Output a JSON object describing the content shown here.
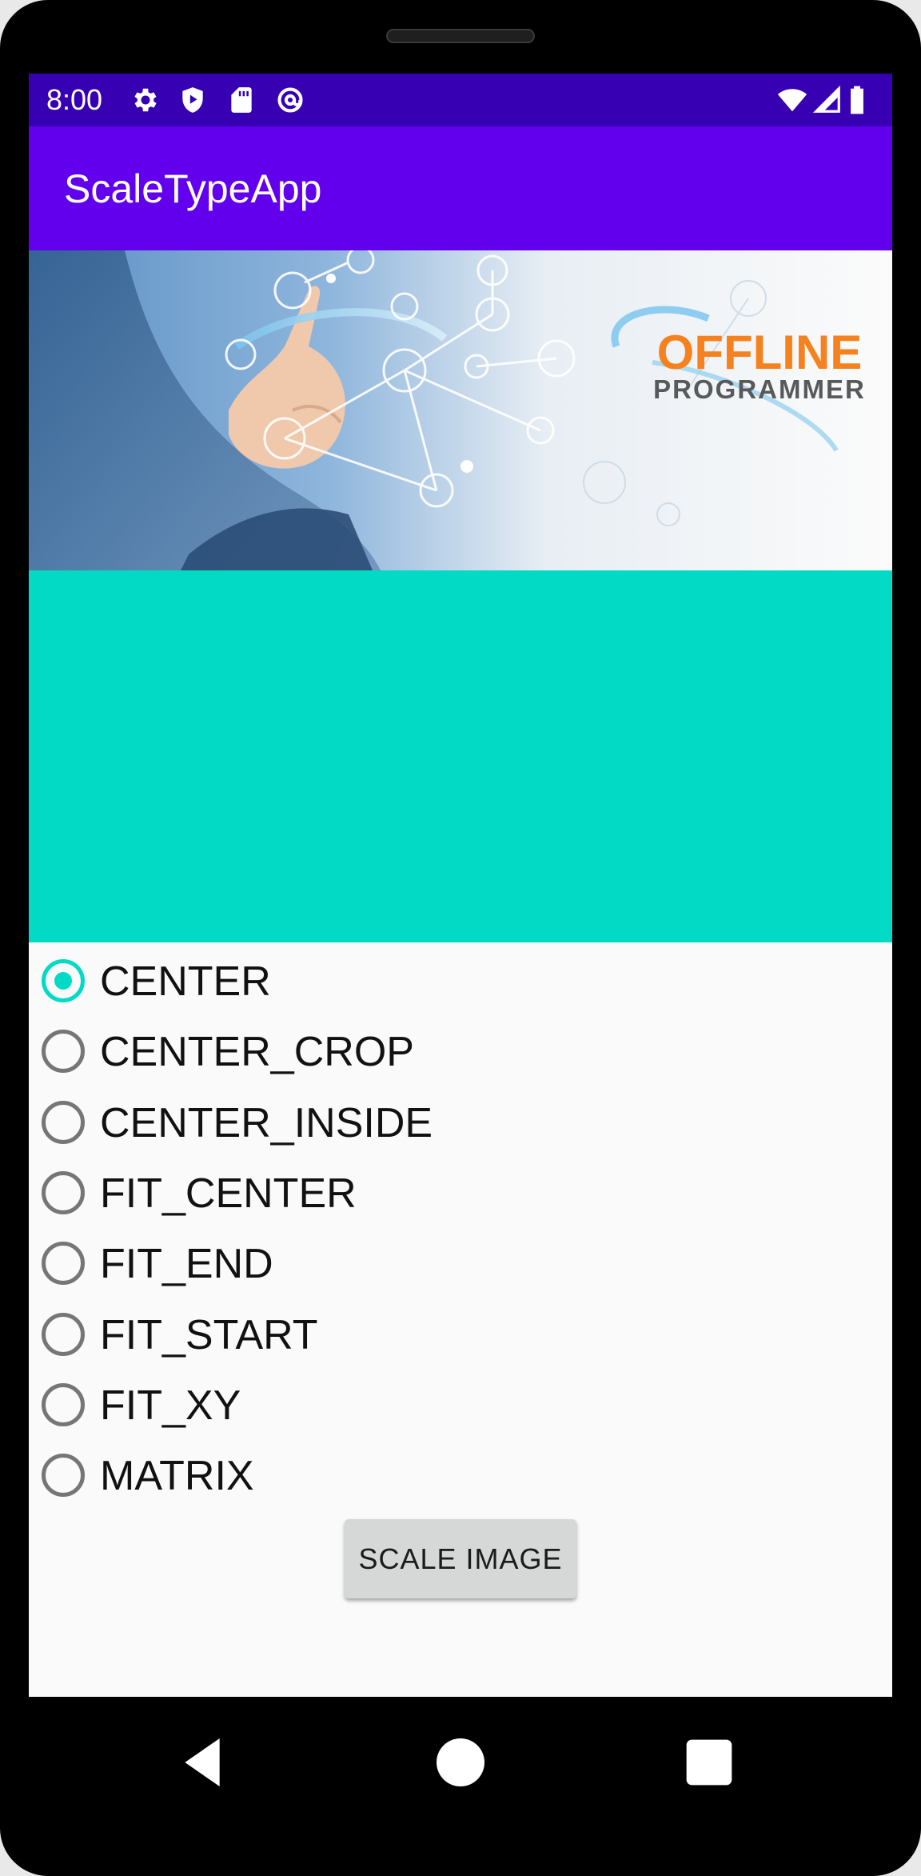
{
  "status_bar": {
    "time": "8:00",
    "left_icons": [
      "gear-icon",
      "shield-play-icon",
      "sd-card-icon",
      "at-sign-icon"
    ],
    "right_icons": [
      "wifi-icon",
      "cell-signal-icon",
      "battery-icon"
    ]
  },
  "app_bar": {
    "title": "ScaleTypeApp"
  },
  "banner": {
    "logo_line1": "OFFLINE",
    "logo_line2": "PROGRAMMER",
    "logo_color": "#f5821f"
  },
  "image_view": {
    "background_color": "#03dac5"
  },
  "scale_types": {
    "options": [
      {
        "label": "CENTER",
        "checked": true
      },
      {
        "label": "CENTER_CROP",
        "checked": false
      },
      {
        "label": "CENTER_INSIDE",
        "checked": false
      },
      {
        "label": "FIT_CENTER",
        "checked": false
      },
      {
        "label": "FIT_END",
        "checked": false
      },
      {
        "label": "FIT_START",
        "checked": false
      },
      {
        "label": "FIT_XY",
        "checked": false
      },
      {
        "label": "MATRIX",
        "checked": false
      }
    ]
  },
  "actions": {
    "scale_button_label": "SCALE IMAGE"
  },
  "nav_bar": {
    "buttons": [
      "back-icon",
      "home-icon",
      "recents-icon"
    ]
  },
  "colors": {
    "primary": "#6200ee",
    "primary_dark": "#3700b3",
    "accent": "#03dac5"
  }
}
